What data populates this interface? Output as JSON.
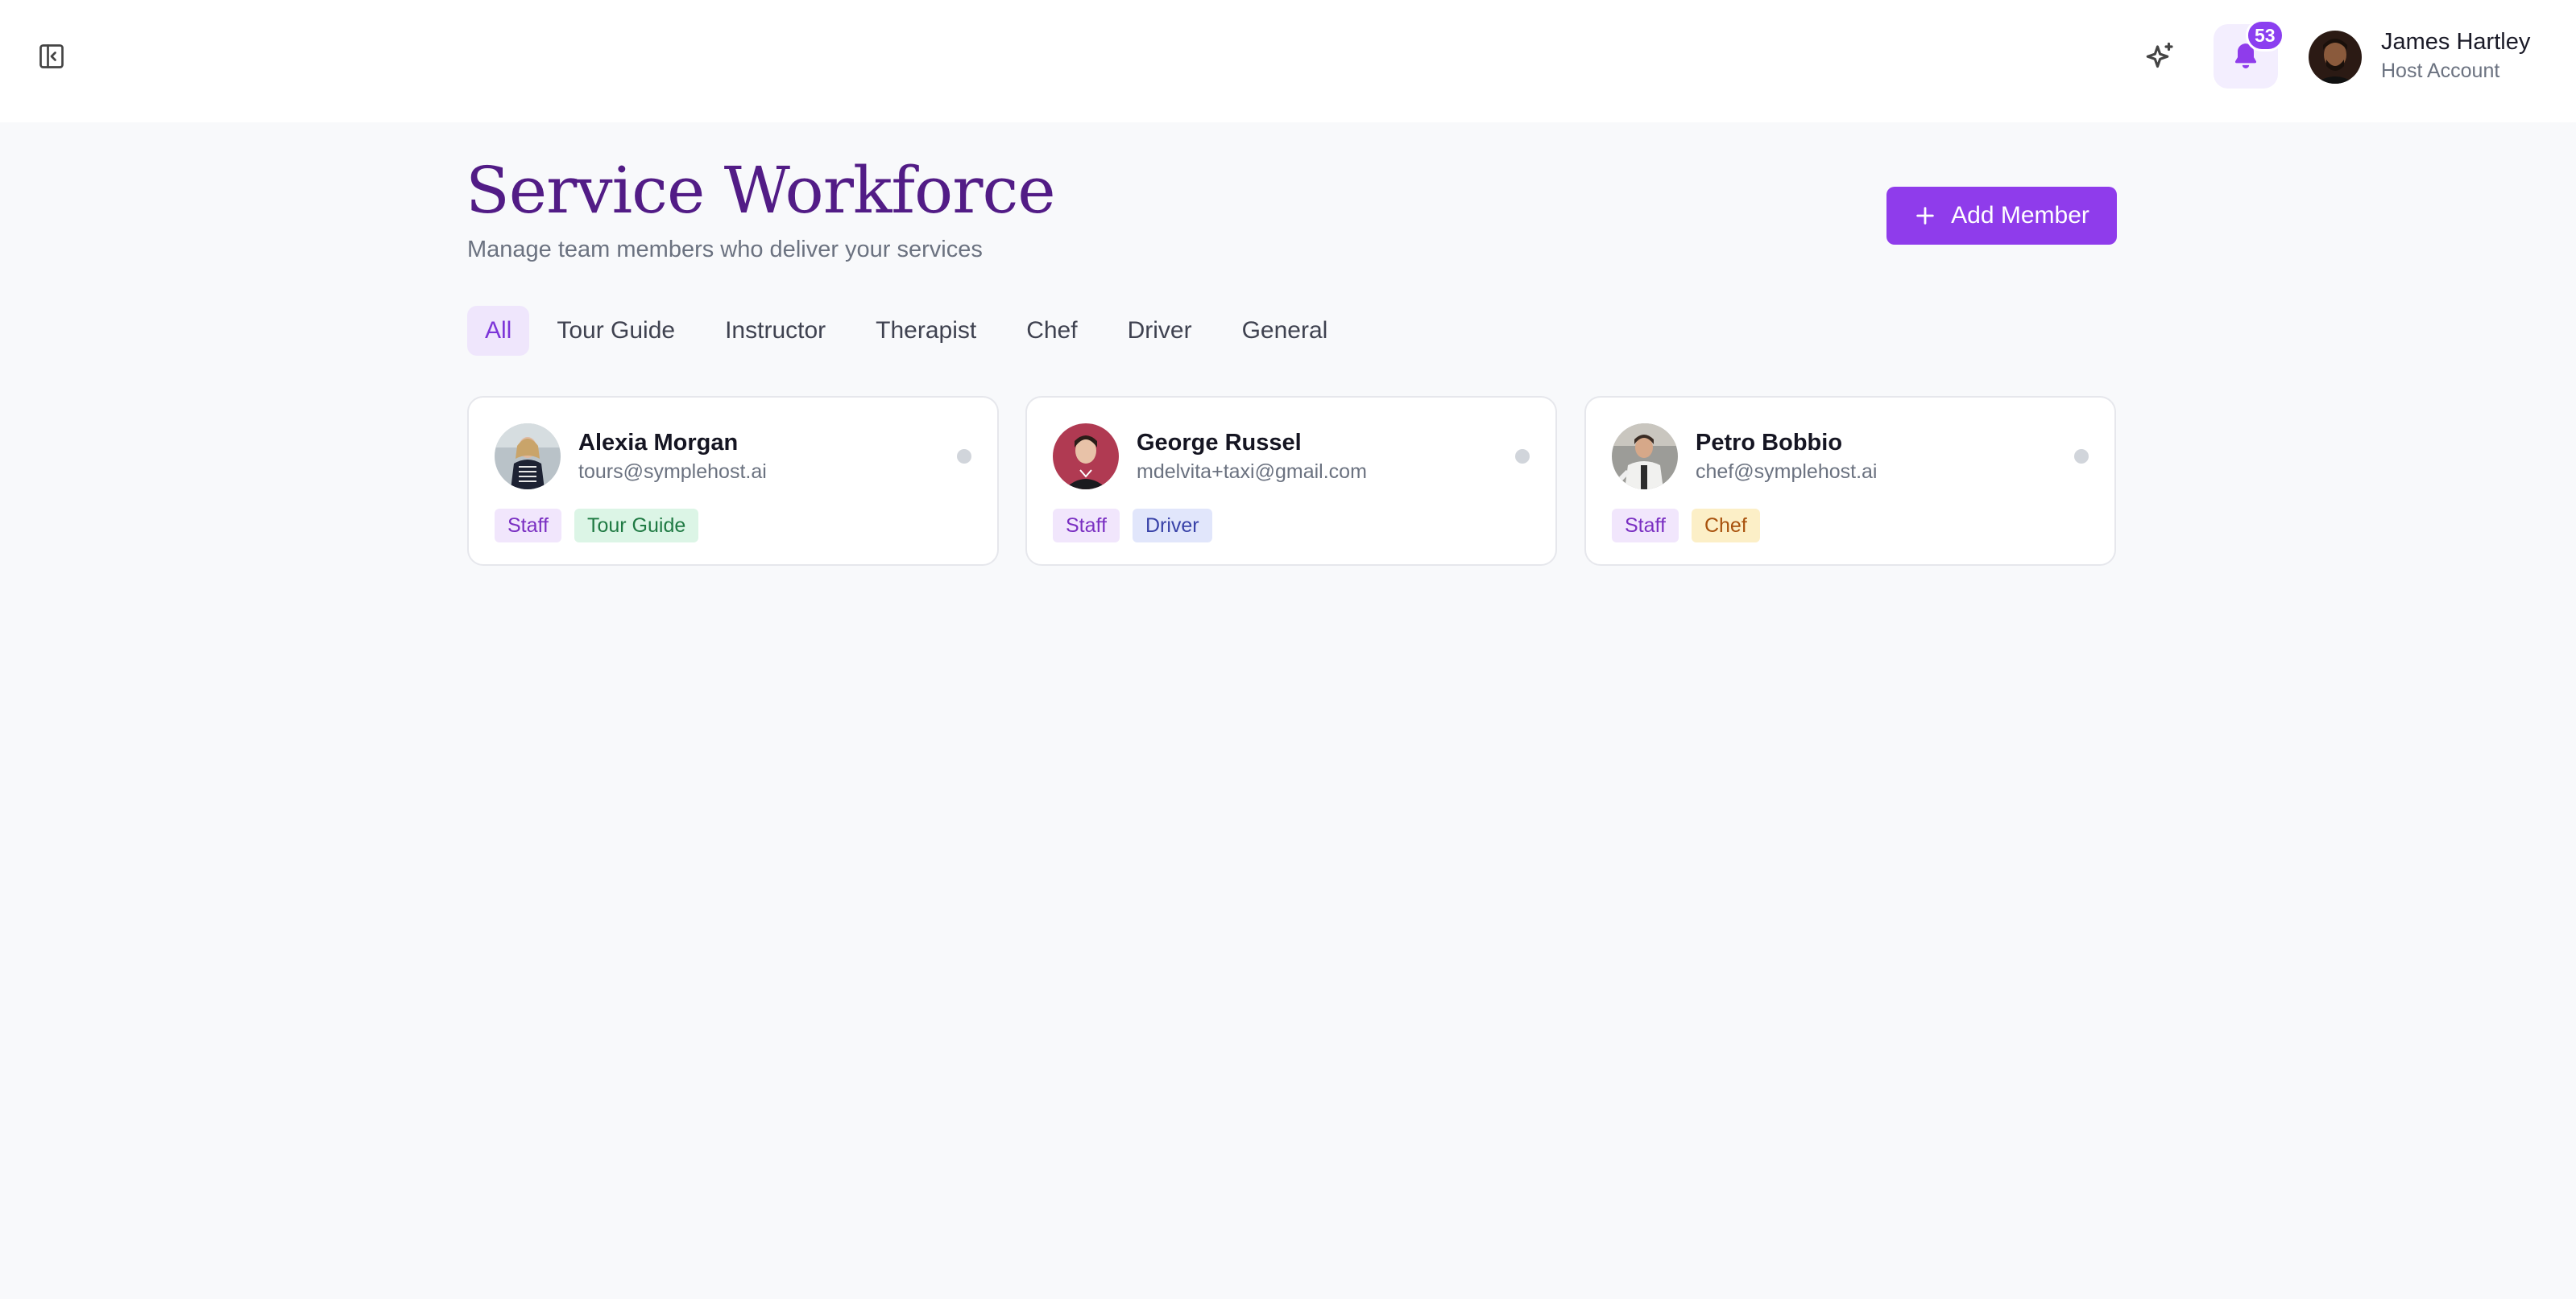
{
  "header": {
    "user": {
      "name": "James Hartley",
      "role": "Host Account"
    },
    "notifications_count": "53",
    "icons": [
      "sidebar-toggle-icon",
      "sparkle-icon",
      "bell-icon"
    ]
  },
  "page": {
    "title": "Service Workforce",
    "subtitle": "Manage team members who deliver your services",
    "add_button_label": "Add Member"
  },
  "tabs": [
    {
      "label": "All",
      "active": true
    },
    {
      "label": "Tour Guide",
      "active": false
    },
    {
      "label": "Instructor",
      "active": false
    },
    {
      "label": "Therapist",
      "active": false
    },
    {
      "label": "Chef",
      "active": false
    },
    {
      "label": "Driver",
      "active": false
    },
    {
      "label": "General",
      "active": false
    }
  ],
  "members": [
    {
      "name": "Alexia Morgan",
      "email": "tours@symplehost.ai",
      "tags": [
        "Staff",
        "Tour Guide"
      ]
    },
    {
      "name": "George Russel",
      "email": "mdelvita+taxi@gmail.com",
      "tags": [
        "Staff",
        "Driver"
      ]
    },
    {
      "name": "Petro Bobbio",
      "email": "chef@symplehost.ai",
      "tags": [
        "Staff",
        "Chef"
      ]
    }
  ],
  "colors": {
    "accent": "#8f3ceb",
    "title": "#521c86",
    "status_inactive": "#d1d5db"
  }
}
